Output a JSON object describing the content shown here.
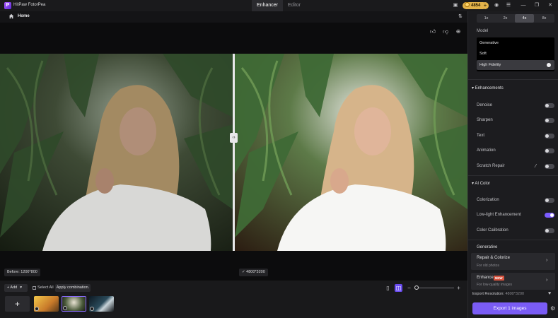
{
  "titlebar": {
    "logo_letter": "P",
    "app_title": "HitPaw FotorPea",
    "tabs": [
      {
        "label": "Enhancer",
        "active": true
      },
      {
        "label": "Editor",
        "active": false
      }
    ],
    "coins": "4854"
  },
  "breadcrumb": {
    "home": "Home"
  },
  "preview": {
    "caption_before": "Before: 1200*800",
    "caption_after": "4800*3200"
  },
  "bottom_bar": {
    "add_label": "+ Add",
    "select_all": "Select All",
    "apply_combination": "Apply combination.",
    "add_tile": "+"
  },
  "right_panel": {
    "scales": [
      {
        "label": "1x",
        "active": false
      },
      {
        "label": "2x",
        "active": false
      },
      {
        "label": "4x",
        "active": true
      },
      {
        "label": "8x",
        "active": false
      }
    ],
    "model_label": "Model",
    "models": [
      {
        "label": "Generative",
        "selected": false
      },
      {
        "label": "Soft",
        "selected": false
      },
      {
        "label": "High Fidelity",
        "selected": true
      }
    ],
    "enhancements": {
      "title": "Enhancements",
      "options": [
        {
          "label": "Denoise",
          "on": false
        },
        {
          "label": "Sharpen",
          "on": false
        },
        {
          "label": "Text",
          "on": false
        },
        {
          "label": "Animation",
          "on": false
        },
        {
          "label": "Scratch Repair",
          "on": false
        }
      ]
    },
    "ai_color": {
      "title": "AI Color",
      "options": [
        {
          "label": "Colorization",
          "on": false
        },
        {
          "label": "Low-light Enhancement",
          "on": true
        },
        {
          "label": "Color Calibration",
          "on": false
        }
      ]
    },
    "generative": {
      "title": "Generative",
      "cards": [
        {
          "title": "Repair & Colorize",
          "subtitle": "For old photos"
        },
        {
          "title": "Enhancer",
          "badge": "NEW",
          "subtitle": "For low-quality images"
        }
      ]
    },
    "export": {
      "resolution_label": "Export Resolution:",
      "resolution_value": "4800*3200",
      "button": "Export 1 images"
    }
  },
  "colors": {
    "accent": "#7a5cf5",
    "coin": "#e2b24a",
    "new_badge": "#d6533f"
  }
}
